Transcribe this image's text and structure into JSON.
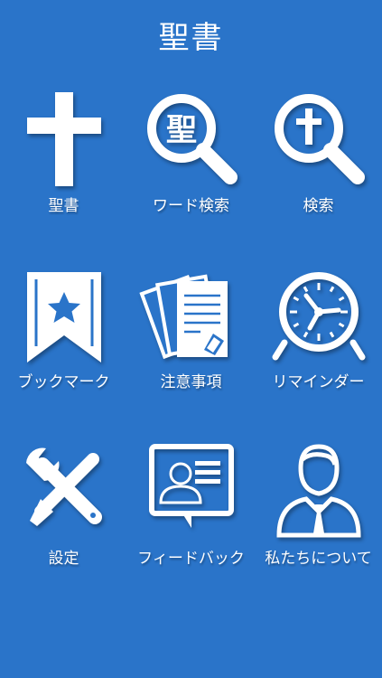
{
  "header": {
    "title": "聖書"
  },
  "menu": [
    {
      "label": "聖書",
      "icon": "cross-icon"
    },
    {
      "label": "ワード検索",
      "icon": "word-search-icon",
      "glyph": "聖"
    },
    {
      "label": "検索",
      "icon": "cross-search-icon"
    },
    {
      "label": "ブックマーク",
      "icon": "bookmark-star-icon"
    },
    {
      "label": "注意事項",
      "icon": "notes-pen-icon"
    },
    {
      "label": "リマインダー",
      "icon": "alarm-clock-icon"
    },
    {
      "label": "設定",
      "icon": "wrench-screwdriver-icon"
    },
    {
      "label": "フィードバック",
      "icon": "feedback-screen-icon"
    },
    {
      "label": "私たちについて",
      "icon": "person-icon"
    }
  ],
  "colors": {
    "background": "#2a74c9",
    "foreground": "#ffffff"
  }
}
